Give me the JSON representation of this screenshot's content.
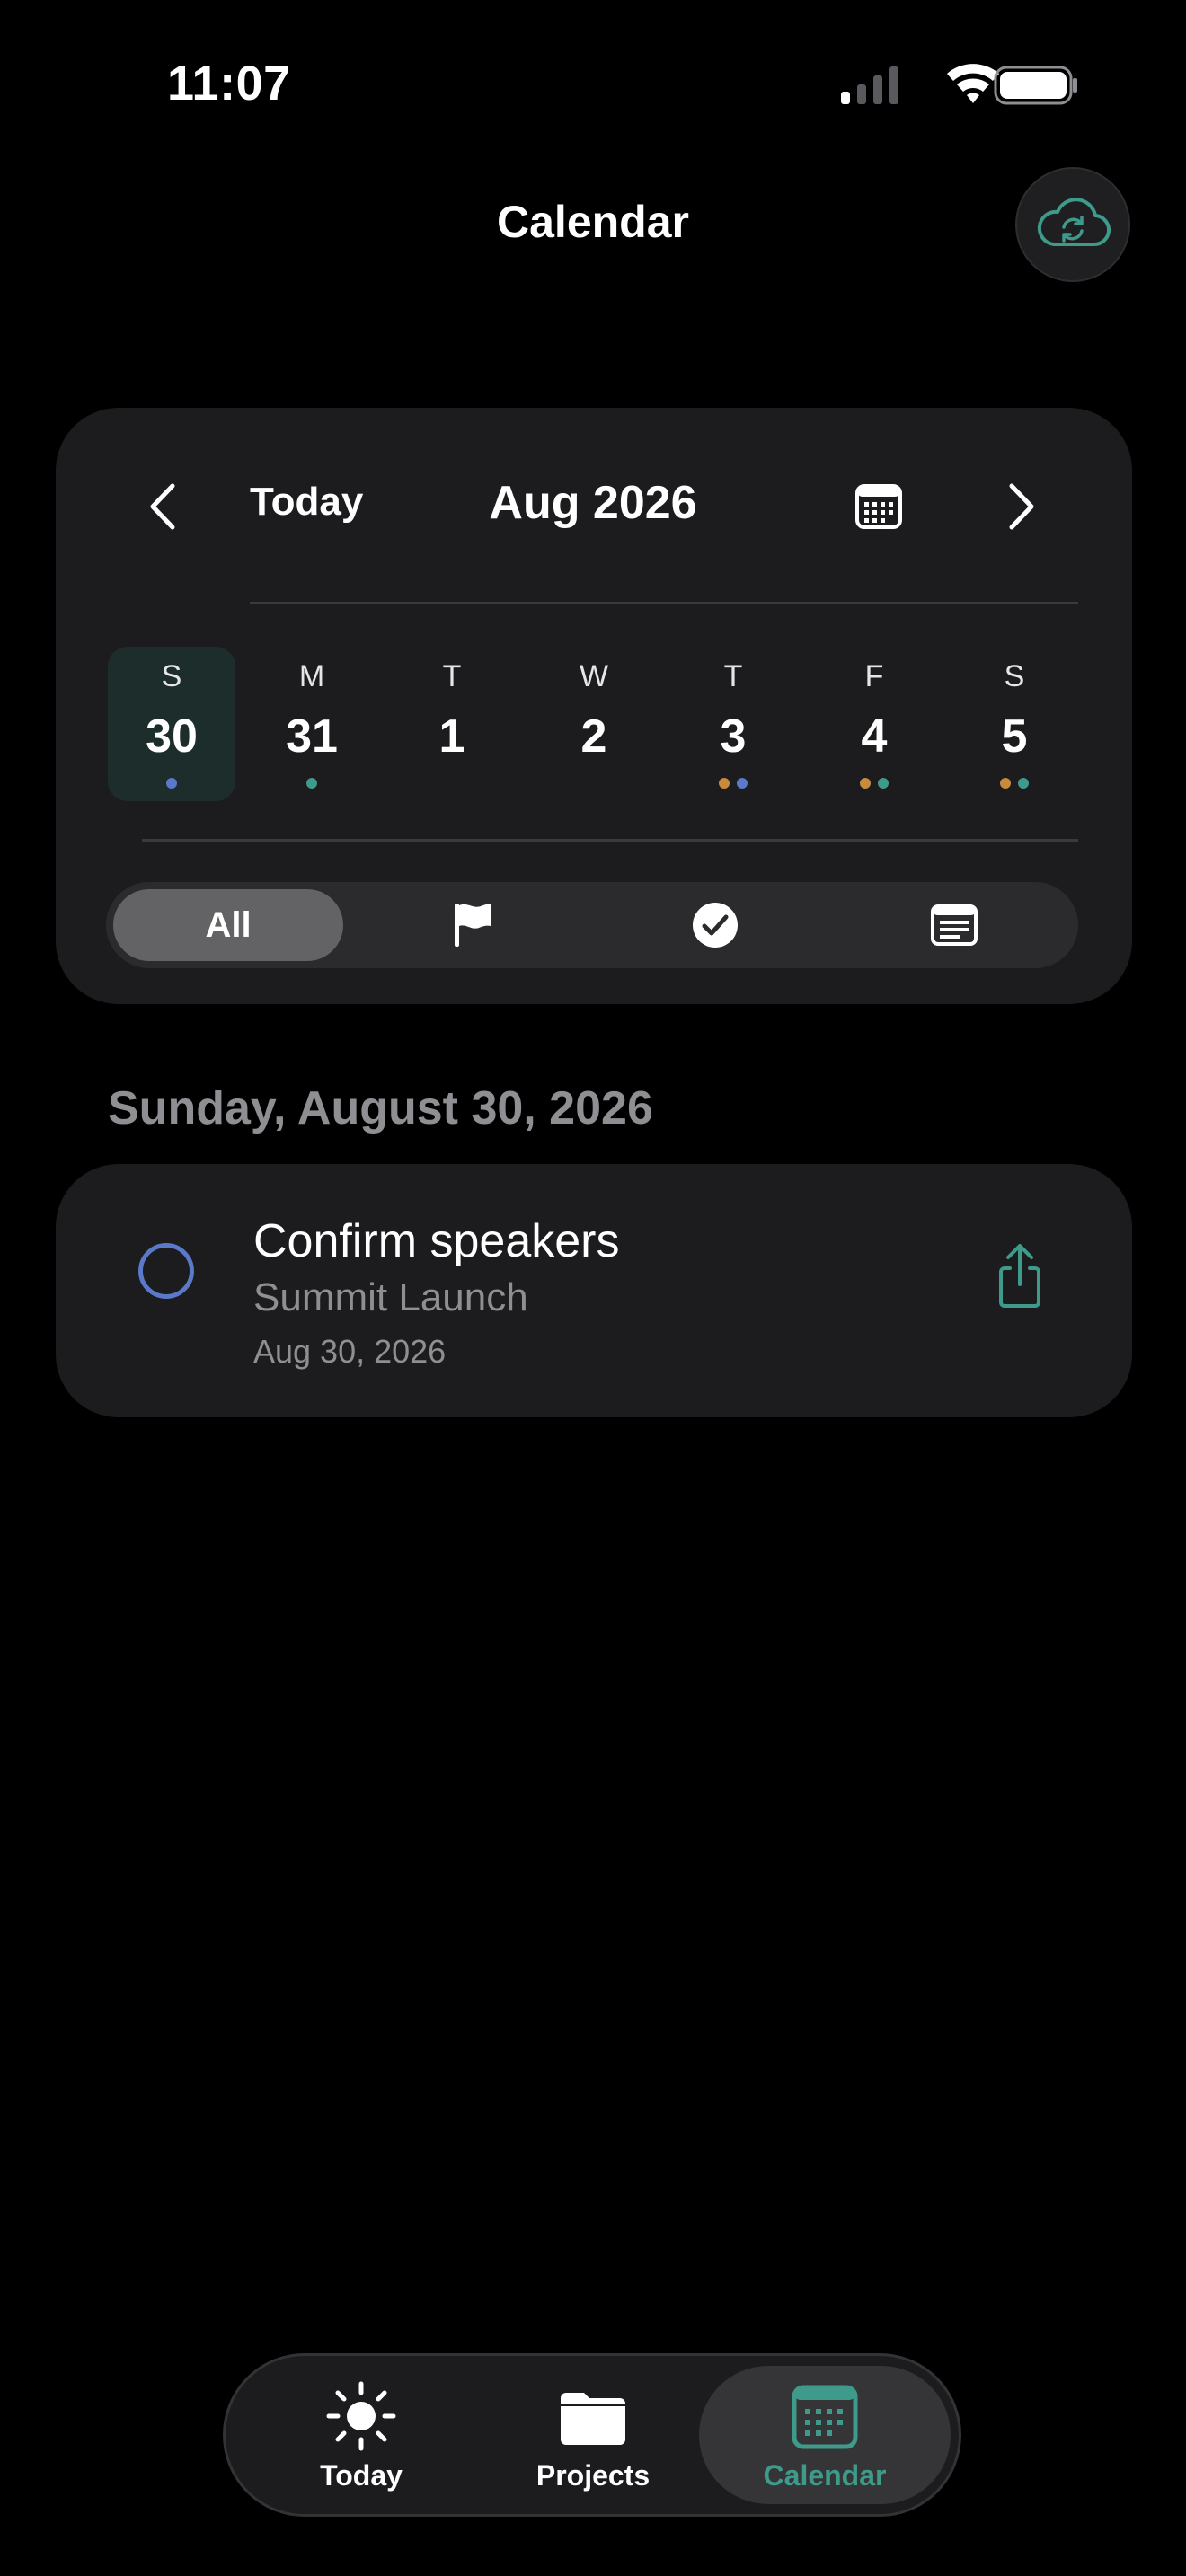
{
  "status_bar": {
    "time": "11:07"
  },
  "header": {
    "title": "Calendar",
    "sync_icon": "cloud-sync-icon"
  },
  "calendar": {
    "today_label": "Today",
    "month_label": "Aug 2026",
    "days": [
      {
        "letter": "S",
        "number": "30",
        "selected": true,
        "dots": [
          "#5b79c9"
        ]
      },
      {
        "letter": "M",
        "number": "31",
        "selected": false,
        "dots": [
          "#3e9a8a"
        ]
      },
      {
        "letter": "T",
        "number": "1",
        "selected": false,
        "dots": []
      },
      {
        "letter": "W",
        "number": "2",
        "selected": false,
        "dots": []
      },
      {
        "letter": "T",
        "number": "3",
        "selected": false,
        "dots": [
          "#c98a3e",
          "#5b79c9"
        ]
      },
      {
        "letter": "F",
        "number": "4",
        "selected": false,
        "dots": [
          "#c98a3e",
          "#3e9a8a"
        ]
      },
      {
        "letter": "S",
        "number": "5",
        "selected": false,
        "dots": [
          "#c98a3e",
          "#3e9a8a"
        ]
      }
    ],
    "filters": {
      "all_label": "All",
      "icons": [
        "flag-icon",
        "checkmark-circle-icon",
        "note-icon"
      ],
      "selected": "All"
    }
  },
  "agenda": {
    "date_heading": "Sunday, August 30, 2026",
    "tasks": [
      {
        "title": "Confirm speakers",
        "project": "Summit Launch",
        "date": "Aug 30, 2026"
      }
    ]
  },
  "tab_bar": {
    "tabs": [
      {
        "label": "Today",
        "icon": "sun-icon"
      },
      {
        "label": "Projects",
        "icon": "folder-icon"
      },
      {
        "label": "Calendar",
        "icon": "calendar-icon"
      }
    ],
    "active": "Calendar"
  },
  "colors": {
    "accent": "#3e9a8a",
    "task_circle": "#5b79c9",
    "background": "#000000",
    "card": "#1c1c1e"
  }
}
